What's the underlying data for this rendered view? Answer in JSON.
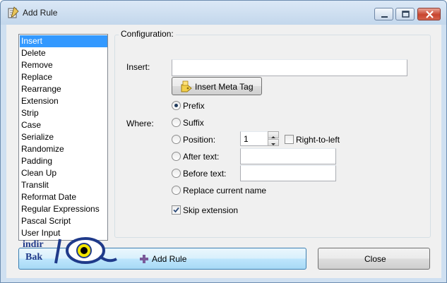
{
  "window": {
    "title": "Add Rule",
    "colors": {
      "frame": "#cfe0f1",
      "selection": "#3399ff",
      "close_button": "#c8452f"
    }
  },
  "rule_list": {
    "items": [
      "Insert",
      "Delete",
      "Remove",
      "Replace",
      "Rearrange",
      "Extension",
      "Strip",
      "Case",
      "Serialize",
      "Randomize",
      "Padding",
      "Clean Up",
      "Translit",
      "Reformat Date",
      "Regular Expressions",
      "Pascal Script",
      "User Input"
    ],
    "selected_index": 0
  },
  "config": {
    "legend": "Configuration:",
    "insert_label": "Insert:",
    "insert_value": "",
    "insert_meta_tag_label": "Insert Meta Tag",
    "where_label": "Where:",
    "options": {
      "prefix": "Prefix",
      "suffix": "Suffix",
      "position": "Position:",
      "after_text": "After text:",
      "before_text": "Before text:",
      "replace_name": "Replace current name"
    },
    "selected_option": "prefix",
    "position_value": "1",
    "right_to_left_label": "Right-to-left",
    "right_to_left_checked": false,
    "after_text_value": "",
    "before_text_value": "",
    "skip_extension_label": "Skip extension",
    "skip_extension_checked": true
  },
  "buttons": {
    "add_rule": "Add Rule",
    "close": "Close"
  },
  "watermark": {
    "line1": "indir",
    "line2": "Bak"
  }
}
